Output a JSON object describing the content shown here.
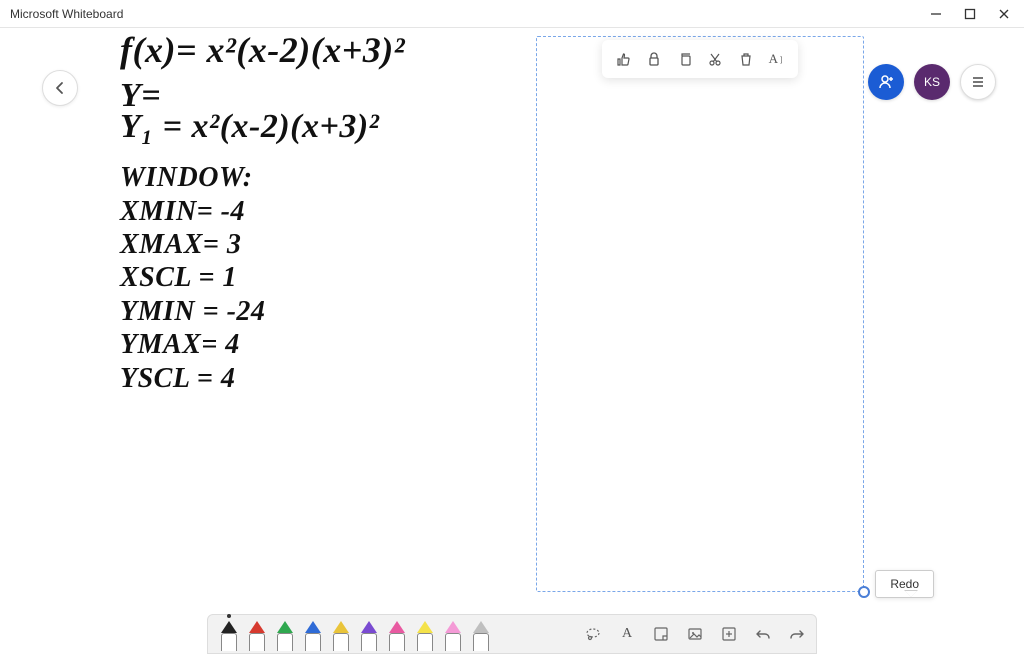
{
  "app": {
    "title": "Microsoft Whiteboard"
  },
  "window_controls": {
    "minimize": "minimize",
    "maximize": "maximize",
    "close": "close"
  },
  "top_right": {
    "invite_icon": "person-plus",
    "avatar_initials": "KS",
    "menu_icon": "hamburger"
  },
  "back_icon": "arrow-left",
  "selection_toolbar": {
    "items": [
      {
        "name": "like-icon"
      },
      {
        "name": "lock-icon"
      },
      {
        "name": "copy-icon"
      },
      {
        "name": "cut-icon"
      },
      {
        "name": "delete-icon"
      },
      {
        "name": "alt-text-icon"
      }
    ]
  },
  "handwriting": {
    "line1": "f(x)= x²(x-2)(x+3)²",
    "line2": "Y=",
    "line3": "Y₁ = x²(x-2)(x+3)²",
    "window_heading": "WINDOW:",
    "xmin": "XMIN= -4",
    "xmax": "XMAX= 3",
    "xscl": "XSCL = 1",
    "ymin": "YMIN = -24",
    "ymax": "YMAX= 4",
    "yscl": "YSCL = 4"
  },
  "tooltip": {
    "redo": "Redo"
  },
  "bottom_toolbar": {
    "pens": [
      {
        "name": "pen-black",
        "color": "#222222",
        "active": true
      },
      {
        "name": "pen-red",
        "color": "#d63a2f"
      },
      {
        "name": "pen-green",
        "color": "#2fa84f"
      },
      {
        "name": "pen-blue",
        "color": "#2f6bd6"
      },
      {
        "name": "pen-yellow",
        "color": "#e9c43a"
      },
      {
        "name": "pen-purple",
        "color": "#7a4bd1"
      },
      {
        "name": "pen-rainbow",
        "color": "#e85aa1"
      },
      {
        "name": "highlighter-yellow",
        "color": "#f4e24a"
      },
      {
        "name": "highlighter-pink",
        "color": "#f49ad6"
      },
      {
        "name": "eraser",
        "color": "#bfbfbf"
      }
    ],
    "tools": [
      {
        "name": "lasso-icon"
      },
      {
        "name": "text-icon",
        "label": "A"
      },
      {
        "name": "note-icon"
      },
      {
        "name": "image-icon"
      },
      {
        "name": "add-icon"
      },
      {
        "name": "undo-icon"
      },
      {
        "name": "redo-icon"
      }
    ]
  }
}
